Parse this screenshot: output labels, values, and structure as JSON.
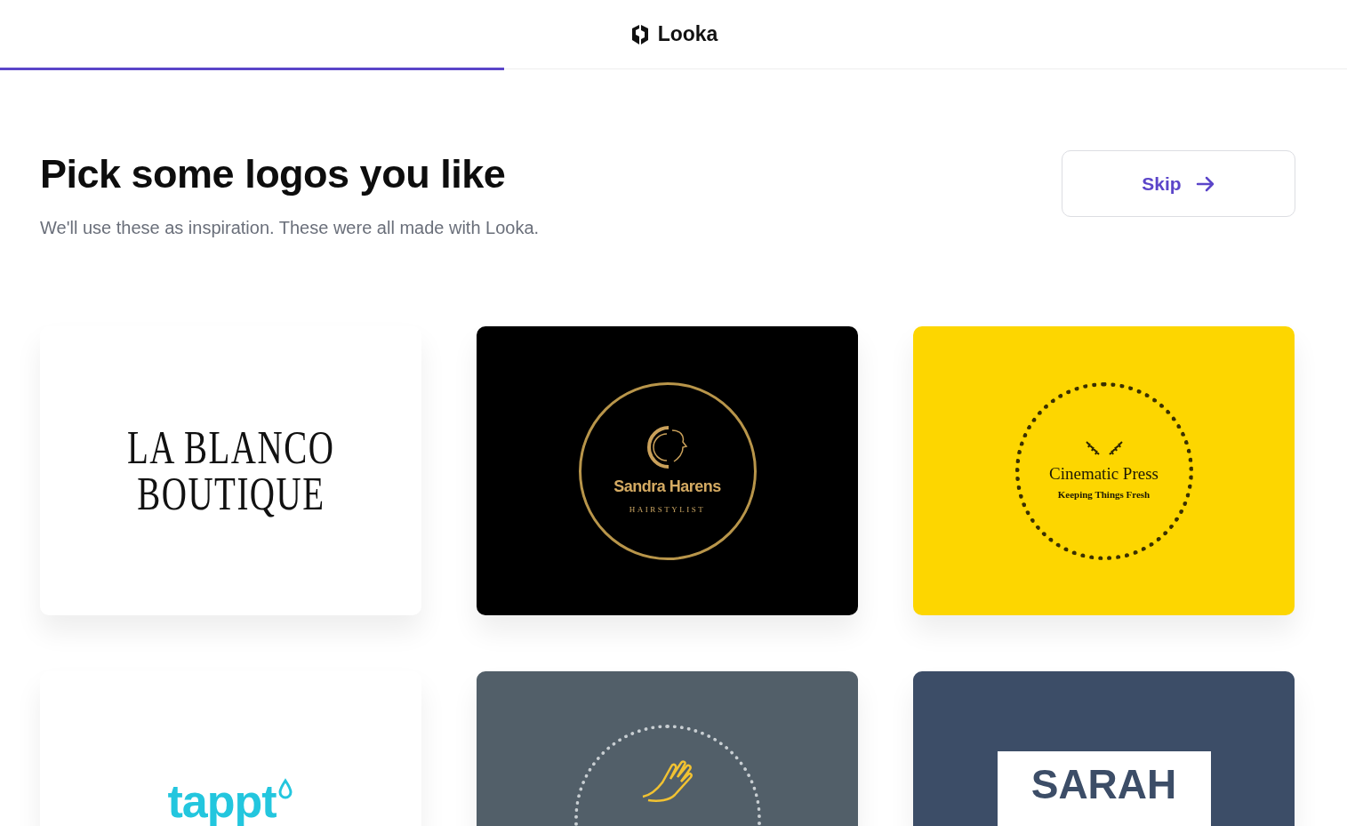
{
  "header": {
    "brand": "Looka"
  },
  "progress": {
    "level": 0.374
  },
  "heading": {
    "title": "Pick some logos you like",
    "subtitle": "We'll use these as inspiration. These were all made with Looka."
  },
  "skip_button": {
    "label": "Skip"
  },
  "logos": [
    {
      "kind": "serif-wordmark",
      "color": "#ffffff",
      "lines": [
        "LA BLANCO",
        "BOUTIQUE"
      ]
    },
    {
      "kind": "gold-circle",
      "color": "#000000",
      "lines": [
        "Sandra Harens",
        "HAIRSTYLIST"
      ]
    },
    {
      "kind": "dotted-circle",
      "color": "#fdd600",
      "lines": [
        "Cinematic Press",
        "Keeping Things Fresh"
      ]
    },
    {
      "kind": "drop-wordmark",
      "color": "#ffffff",
      "lines": [
        "tappt"
      ]
    },
    {
      "kind": "hand-circle",
      "color": "#525f69"
    },
    {
      "kind": "name-block",
      "color": "#3c4d67",
      "lines": [
        "SARAH"
      ]
    }
  ]
}
